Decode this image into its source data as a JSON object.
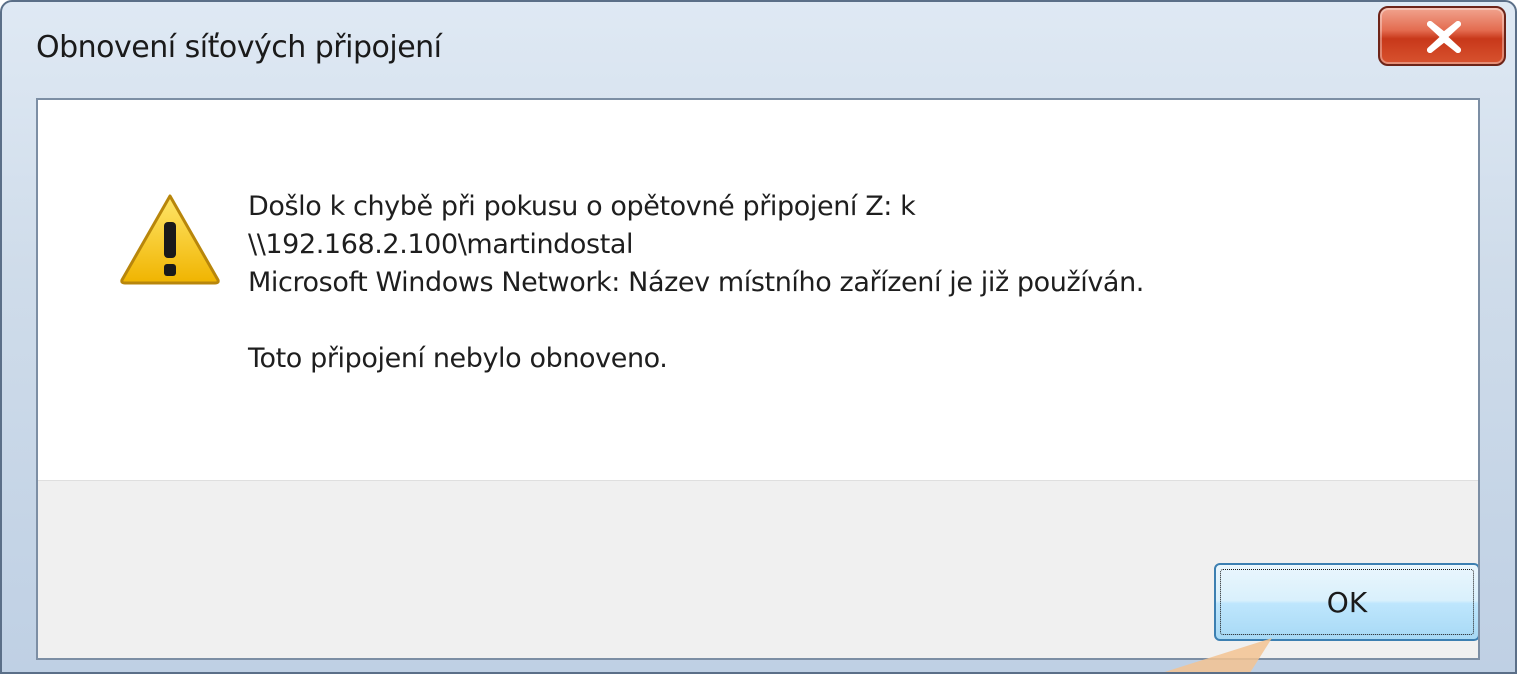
{
  "window": {
    "title": "Obnovení síťových připojení"
  },
  "message": {
    "line1": "Došlo k chybě při pokusu o opětovné připojení Z: k",
    "line2": "\\\\192.168.2.100\\martindostal",
    "line3": "Microsoft Windows Network: Název místního zařízení je již používán.",
    "line4": "Toto připojení nebylo obnoveno."
  },
  "buttons": {
    "ok_label": "OK"
  },
  "icons": {
    "warning": "warning-icon",
    "close": "close-icon"
  },
  "colors": {
    "close_button": "#c8381a",
    "warning_fill": "#f5c400",
    "ok_button_border": "#3c7fb1"
  }
}
